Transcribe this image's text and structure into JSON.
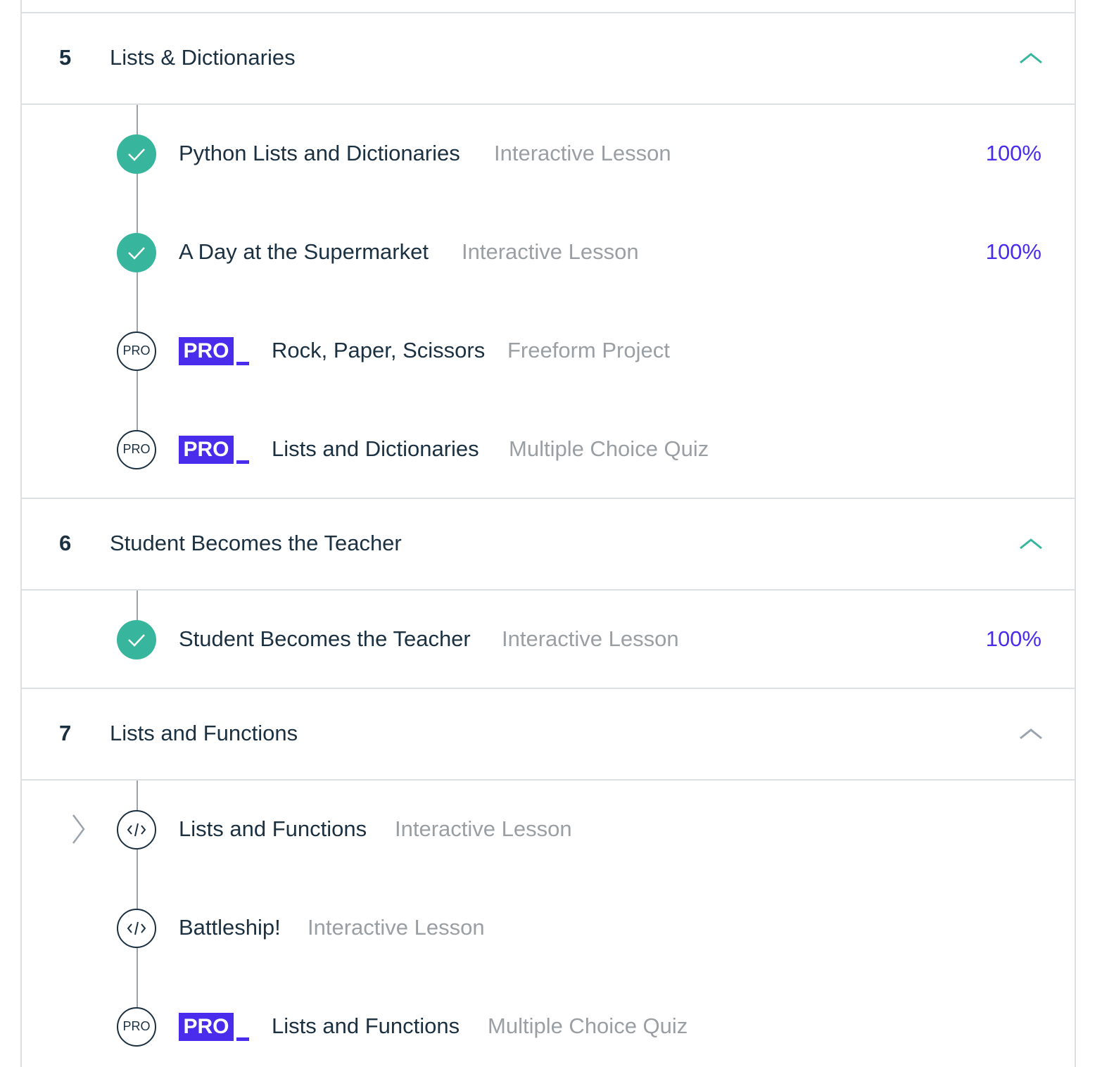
{
  "sections": [
    {
      "number": "5",
      "title": "Lists & Dictionaries",
      "items": [
        {
          "title": "Python Lists and Dictionaries",
          "type": "Interactive Lesson",
          "progress": "100%"
        },
        {
          "title": "A Day at the Supermarket",
          "type": "Interactive Lesson",
          "progress": "100%"
        },
        {
          "badge": "PRO",
          "node_label": "PRO",
          "title": "Rock, Paper, Scissors",
          "type": "Freeform Project"
        },
        {
          "badge": "PRO",
          "node_label": "PRO",
          "title": "Lists and Dictionaries",
          "type": "Multiple Choice Quiz"
        }
      ]
    },
    {
      "number": "6",
      "title": "Student Becomes the Teacher",
      "items": [
        {
          "title": "Student Becomes the Teacher",
          "type": "Interactive Lesson",
          "progress": "100%"
        }
      ]
    },
    {
      "number": "7",
      "title": "Lists and Functions",
      "items": [
        {
          "title": "Lists and Functions",
          "type": "Interactive Lesson"
        },
        {
          "title": "Battleship!",
          "type": "Interactive Lesson"
        },
        {
          "badge": "PRO",
          "node_label": "PRO",
          "title": "Lists and Functions",
          "type": "Multiple Choice Quiz"
        }
      ]
    }
  ],
  "colors": {
    "accent_green": "#37b69d",
    "pro_purple": "#4a2dec",
    "text_dark": "#1b3142",
    "text_muted": "#9a9fa3",
    "divider": "#dde0e3"
  },
  "icons": {
    "section_toggle": "chevron-up-icon",
    "completed": "check-circle-icon",
    "locked": "pro-circle-icon",
    "lesson": "code-circle-icon",
    "current": "chevron-right-icon"
  }
}
